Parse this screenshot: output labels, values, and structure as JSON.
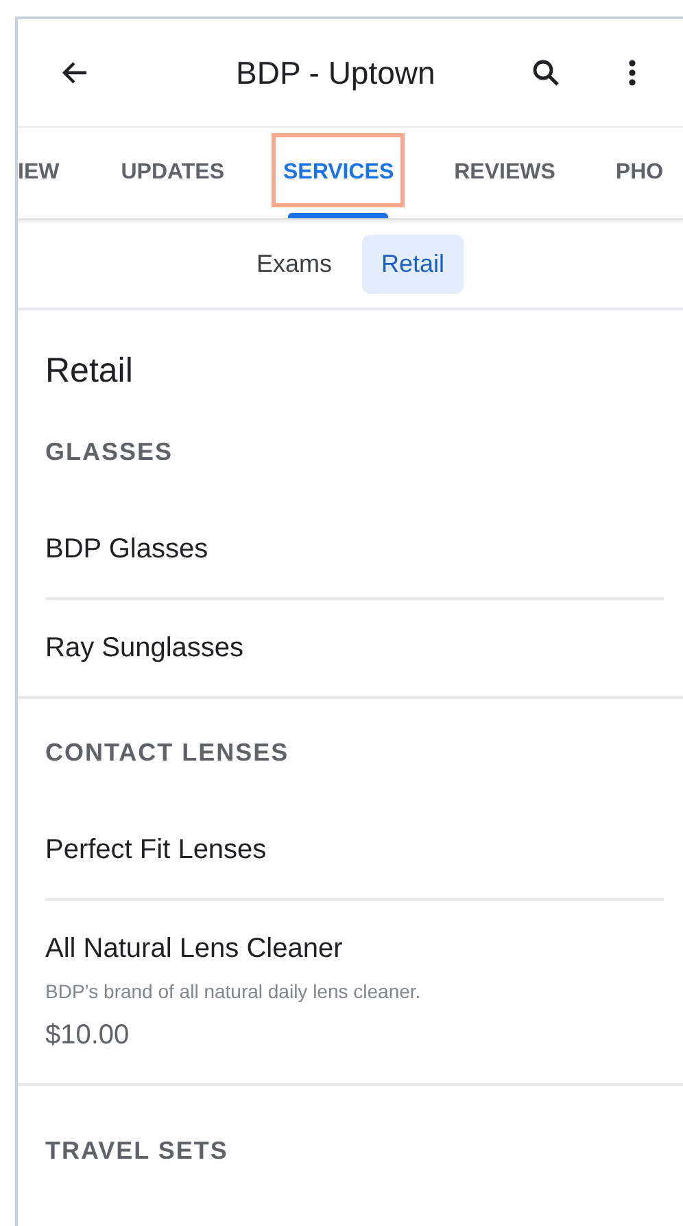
{
  "app_bar": {
    "title": "BDP - Uptown"
  },
  "tabs": [
    {
      "label": "IEW",
      "selected": false,
      "highlighted": false
    },
    {
      "label": "UPDATES",
      "selected": false,
      "highlighted": false
    },
    {
      "label": "SERVICES",
      "selected": true,
      "highlighted": true
    },
    {
      "label": "REVIEWS",
      "selected": false,
      "highlighted": false
    },
    {
      "label": "PHO",
      "selected": false,
      "highlighted": false
    }
  ],
  "chips": [
    {
      "label": "Exams",
      "selected": false
    },
    {
      "label": "Retail",
      "selected": true
    }
  ],
  "heading": "Retail",
  "sections": [
    {
      "title": "GLASSES",
      "items": [
        {
          "name": "BDP Glasses"
        },
        {
          "name": "Ray Sunglasses"
        }
      ]
    },
    {
      "title": "CONTACT LENSES",
      "items": [
        {
          "name": "Perfect Fit Lenses"
        },
        {
          "name": "All Natural Lens Cleaner",
          "description": "BDP’s brand of all natural daily lens cleaner.",
          "price": "$10.00"
        }
      ]
    },
    {
      "title": "TRAVEL SETS"
    }
  ]
}
